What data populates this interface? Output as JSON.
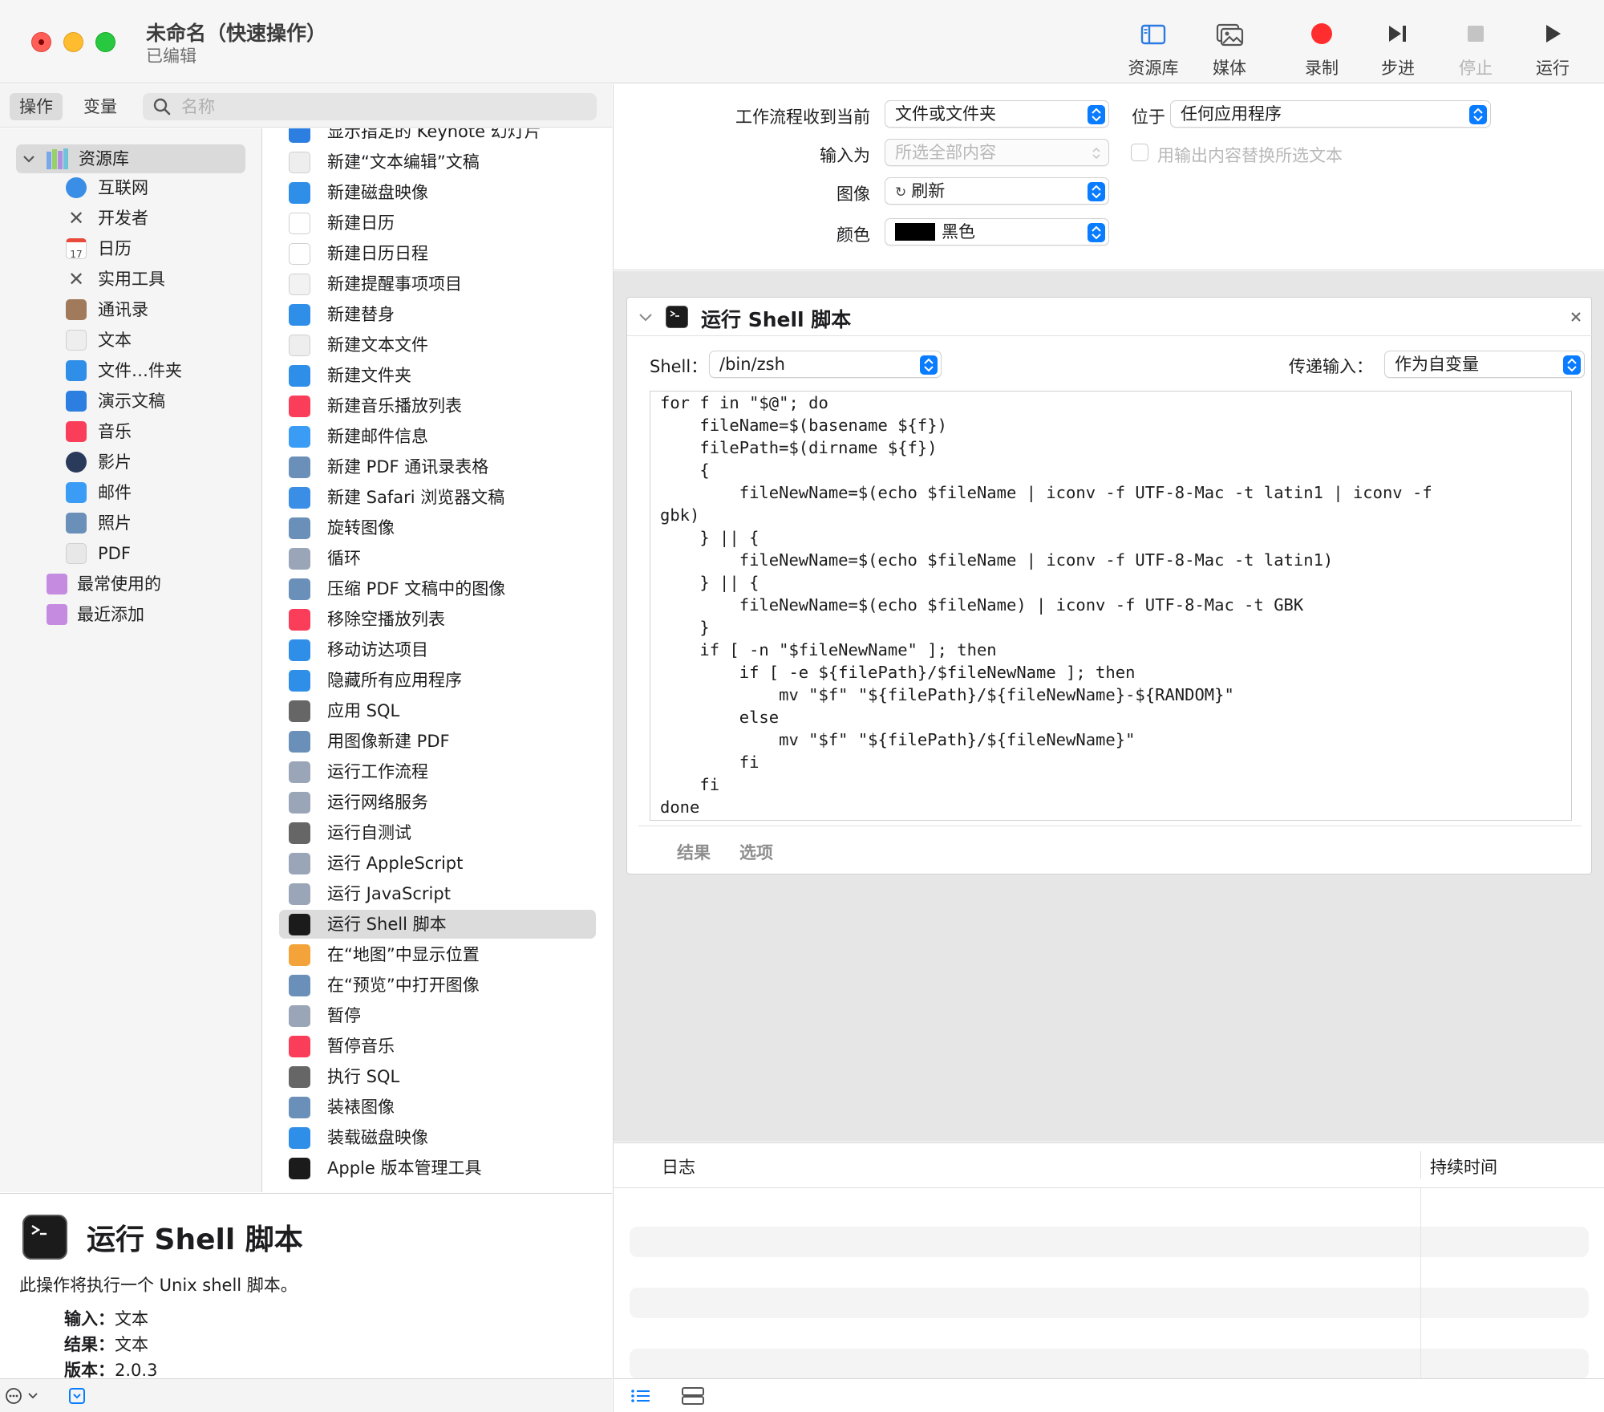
{
  "window": {
    "title": "未命名（快速操作）",
    "subtitle": "已编辑"
  },
  "toolbar": {
    "library": "资源库",
    "media": "媒体",
    "record": "录制",
    "step": "步进",
    "stop": "停止",
    "run": "运行"
  },
  "left_tabs": {
    "actions": "操作",
    "variables": "变量",
    "search_placeholder": "名称"
  },
  "library": {
    "root": "资源库",
    "items": [
      "互联网",
      "开发者",
      "日历",
      "实用工具",
      "通讯录",
      "文本",
      "文件…件夹",
      "演示文稿",
      "音乐",
      "影片",
      "邮件",
      "照片",
      "PDF"
    ],
    "smart": [
      "最常使用的",
      "最近添加"
    ]
  },
  "actions": [
    "显示指定的 Keynote 幻灯片",
    "新建“文本编辑”文稿",
    "新建磁盘映像",
    "新建日历",
    "新建日历日程",
    "新建提醒事项项目",
    "新建替身",
    "新建文本文件",
    "新建文件夹",
    "新建音乐播放列表",
    "新建邮件信息",
    "新建 PDF 通讯录表格",
    "新建 Safari 浏览器文稿",
    "旋转图像",
    "循环",
    "压缩 PDF 文稿中的图像",
    "移除空播放列表",
    "移动访达项目",
    "隐藏所有应用程序",
    "应用 SQL",
    "用图像新建 PDF",
    "运行工作流程",
    "运行网络服务",
    "运行自测试",
    "运行 AppleScript",
    "运行 JavaScript",
    "运行 Shell 脚本",
    "在“地图”中显示位置",
    "在“预览”中打开图像",
    "暂停",
    "暂停音乐",
    "执行 SQL",
    "装裱图像",
    "装载磁盘映像",
    "Apple 版本管理工具"
  ],
  "selected_action": "运行 Shell 脚本",
  "description": {
    "title": "运行 Shell 脚本",
    "text": "此操作将执行一个 Unix shell 脚本。",
    "input_label": "输入：",
    "input_value": "文本",
    "result_label": "结果：",
    "result_value": "文本",
    "version_label": "版本：",
    "version_value": "2.0.3"
  },
  "workflow": {
    "receives_label": "工作流程收到当前",
    "receives_value": "文件或文件夹",
    "in_label": "位于",
    "in_value": "任何应用程序",
    "input_is_label": "输入为",
    "input_is_value": "所选全部内容",
    "replace_label": "用输出内容替换所选文本",
    "image_label": "图像",
    "image_value": "刷新",
    "color_label": "颜色",
    "color_value": "黑色"
  },
  "card": {
    "title": "运行 Shell 脚本",
    "shell_label": "Shell：",
    "shell_value": "/bin/zsh",
    "pass_label": "传递输入：",
    "pass_value": "作为自变量",
    "script": "for f in \"$@\"; do\n    fileName=$(basename ${f})\n    filePath=$(dirname ${f})\n    {\n        fileNewName=$(echo $fileName | iconv -f UTF-8-Mac -t latin1 | iconv -f\ngbk)\n    } || {\n        fileNewName=$(echo $fileName | iconv -f UTF-8-Mac -t latin1)\n    } || {\n        fileNewName=$(echo $fileName) | iconv -f UTF-8-Mac -t GBK\n    }\n    if [ -n \"$fileNewName\" ]; then\n        if [ -e ${filePath}/$fileNewName ]; then\n            mv \"$f\" \"${filePath}/${fileNewName}-${RANDOM}\"\n        else\n            mv \"$f\" \"${filePath}/${fileNewName}\"\n        fi\n    fi\ndone",
    "tab_results": "结果",
    "tab_options": "选项"
  },
  "log": {
    "col_log": "日志",
    "col_duration": "持续时间"
  },
  "colors": {
    "accent": "#0a7cff",
    "record": "#ff2d2d",
    "selection": "#dcdcdc"
  }
}
